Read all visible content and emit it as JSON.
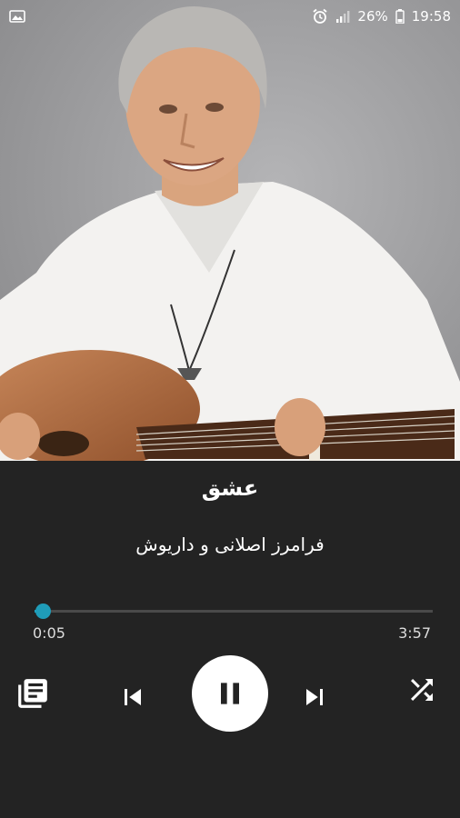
{
  "status_bar": {
    "battery": "26%",
    "time": "19:58"
  },
  "track": {
    "title": "عشق",
    "artist": "فرامرز اصلانی و داریوش"
  },
  "progress": {
    "elapsed": "0:05",
    "total": "3:57",
    "fraction": 0.02
  },
  "colors": {
    "accent": "#1f9cb8",
    "background": "#232323"
  },
  "controls": {
    "queue_icon": "queue-list-icon",
    "prev_icon": "skip-previous-icon",
    "play_icon": "pause-icon",
    "next_icon": "skip-next-icon",
    "shuffle_icon": "shuffle-icon"
  }
}
